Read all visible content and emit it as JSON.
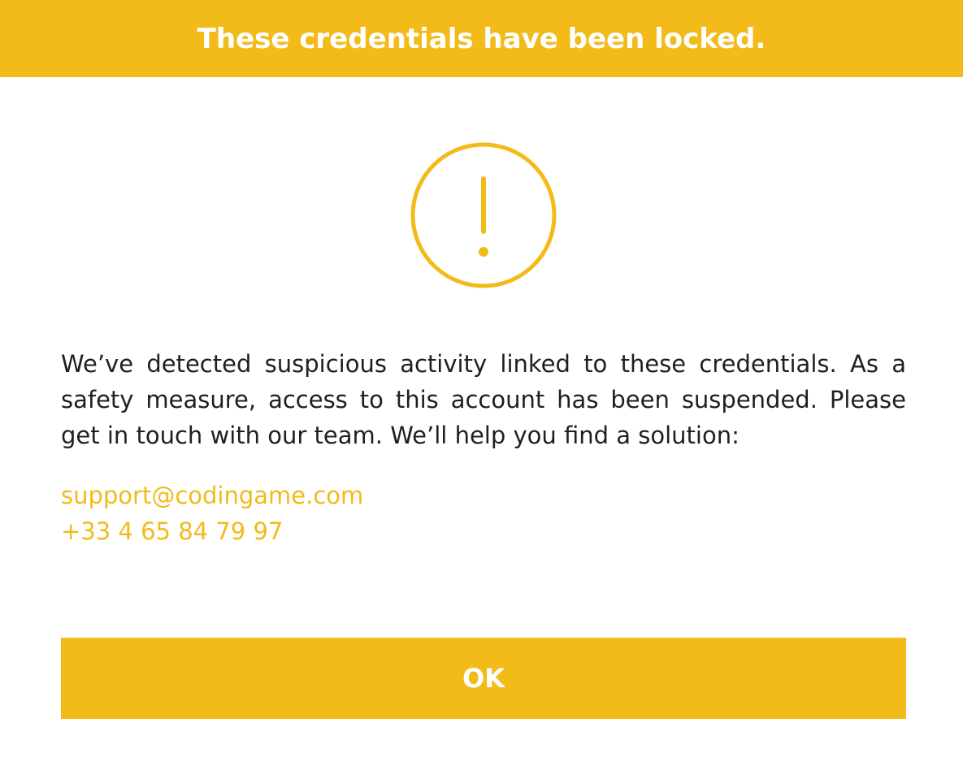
{
  "colors": {
    "accent": "#f2bb19",
    "text": "#1f1f1f",
    "background": "#ffffff"
  },
  "header": {
    "title": "These credentials have been locked."
  },
  "icon": {
    "name": "exclamation-circle-icon"
  },
  "message": {
    "body": "We’ve detected suspicious activity linked to these credentials. As a safety measure, access to this account has been suspended. Please get in touch with our team. We’ll help you find a solution:"
  },
  "contacts": {
    "email": "support@codingame.com",
    "phone": "+33 4 65 84 79 97"
  },
  "actions": {
    "ok_label": "OK"
  }
}
